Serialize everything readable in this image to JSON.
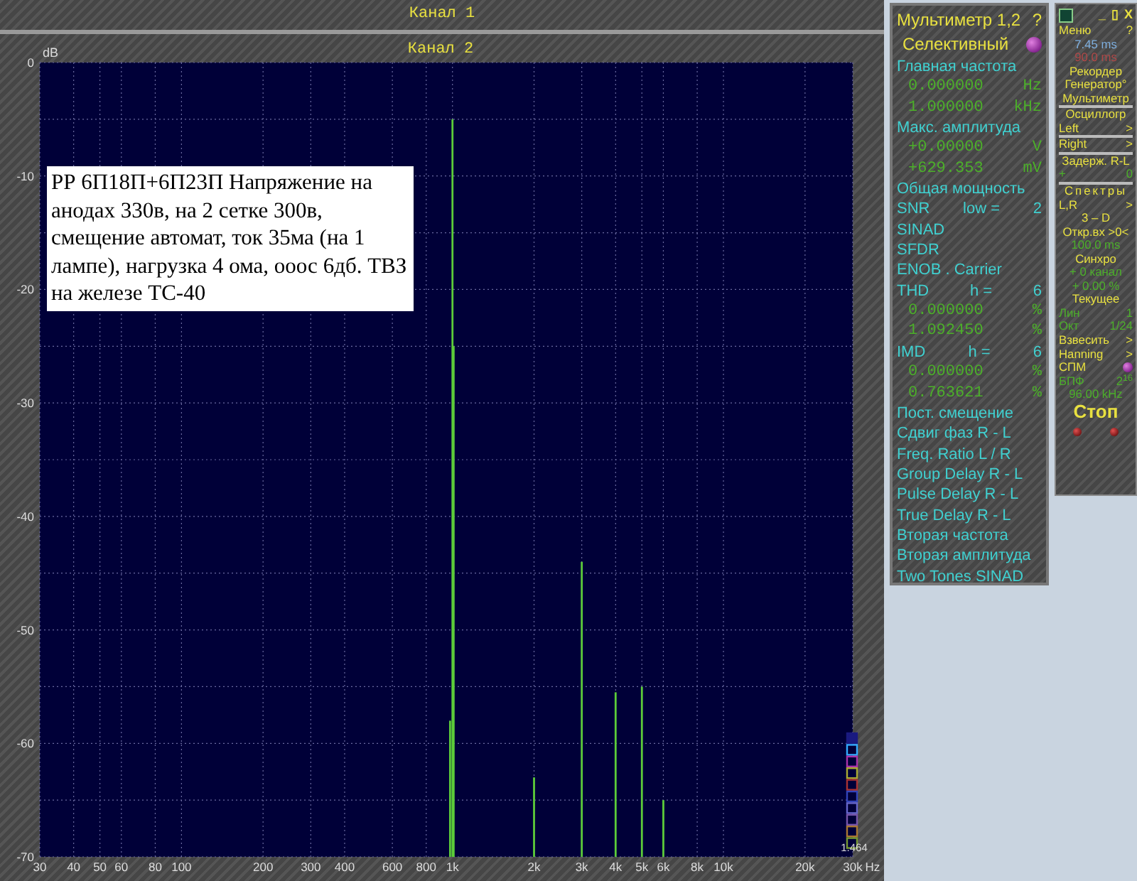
{
  "channel_1": {
    "title": "Канал 1"
  },
  "spectrum": {
    "title": "Канал 2",
    "y_unit": "dB",
    "x_unit": "Hz",
    "y_labels": [
      "0",
      "-10",
      "-20",
      "-30",
      "-40",
      "-50",
      "-60",
      "-70"
    ],
    "x_labels": [
      "30",
      "40",
      "50",
      "60",
      "80",
      "100",
      "200",
      "300",
      "400",
      "600",
      "800",
      "1k",
      "2k",
      "3k",
      "4k",
      "5k",
      "6k",
      "8k",
      "10k",
      "20k",
      "30k"
    ],
    "note": "РР 6П18П+6П23П Напряжение на анодах 330в, на 2 сетке 300в, смещение автомат, ток 35ма (на 1 лампе), нагрузка 4 ома, ооос 6дб. ТВЗ на железе ТС-40",
    "swatches": [
      {
        "color": "#1a1a80"
      },
      {
        "color": "#33aaff"
      },
      {
        "color": "#aa33aa"
      },
      {
        "color": "#aaaa33"
      },
      {
        "color": "#aa3333"
      },
      {
        "color": "#3344bb"
      },
      {
        "color": "#6666cc"
      },
      {
        "color": "#7755aa"
      },
      {
        "color": "#aa7733"
      },
      {
        "color": "#779933"
      }
    ],
    "scale_reading": "1.464"
  },
  "multimeter": {
    "title": "Мультиметр 1,2",
    "help": "?",
    "mode": "Селективный",
    "rows": [
      {
        "kind": "label",
        "cells": [
          "Главная частота"
        ]
      },
      {
        "kind": "value",
        "cells": [
          "0.000000",
          "Hz"
        ]
      },
      {
        "kind": "value",
        "cells": [
          "1.000000",
          "kHz"
        ]
      },
      {
        "kind": "label",
        "cells": [
          "Макс. амплитуда"
        ]
      },
      {
        "kind": "value",
        "cells": [
          "+0.00000",
          "V"
        ]
      },
      {
        "kind": "value",
        "cells": [
          "+629.353",
          "mV"
        ]
      },
      {
        "kind": "label",
        "cells": [
          "Общая мощность"
        ]
      },
      {
        "kind": "label",
        "cells": [
          "SNR",
          "low =",
          "2"
        ]
      },
      {
        "kind": "label",
        "cells": [
          "SINAD"
        ]
      },
      {
        "kind": "label",
        "cells": [
          "SFDR"
        ]
      },
      {
        "kind": "label",
        "cells": [
          "ENOB . Carrier"
        ]
      },
      {
        "kind": "label",
        "cells": [
          "THD",
          "h =",
          "6"
        ]
      },
      {
        "kind": "value",
        "cells": [
          "0.000000",
          "%"
        ]
      },
      {
        "kind": "value",
        "cells": [
          "1.092450",
          "%"
        ]
      },
      {
        "kind": "label",
        "cells": [
          "IMD",
          "h =",
          "6"
        ]
      },
      {
        "kind": "value",
        "cells": [
          "0.000000",
          "%"
        ]
      },
      {
        "kind": "value",
        "cells": [
          "0.763621",
          "%"
        ]
      },
      {
        "kind": "label",
        "cells": [
          "Пост. смещение"
        ]
      },
      {
        "kind": "label",
        "cells": [
          "Сдвиг фаз R - L"
        ]
      },
      {
        "kind": "label",
        "cells": [
          "Freq. Ratio  L / R"
        ]
      },
      {
        "kind": "label",
        "cells": [
          "Group Delay R - L"
        ]
      },
      {
        "kind": "label",
        "cells": [
          "Pulse Delay R - L"
        ]
      },
      {
        "kind": "label",
        "cells": [
          "True Delay R - L"
        ]
      },
      {
        "kind": "label",
        "cells": [
          "Вторая частота"
        ]
      },
      {
        "kind": "label",
        "cells": [
          "Вторая амплитуда"
        ]
      },
      {
        "kind": "label",
        "cells": [
          "Two Tones SINAD"
        ]
      }
    ]
  },
  "control_panel": {
    "rows": [
      {
        "kind": "titlebar",
        "cells": [
          "_",
          "▯",
          "X"
        ]
      },
      {
        "kind": "row",
        "color": "#e8e040",
        "divider_above": false,
        "cells": [
          "Меню",
          "?"
        ]
      },
      {
        "kind": "row",
        "color": "#7fb0e0",
        "divider_above": false,
        "cells": [
          "7.45 ms"
        ]
      },
      {
        "kind": "row",
        "color": "#b04848",
        "divider_above": false,
        "cells": [
          "90.0 ms"
        ]
      },
      {
        "kind": "row",
        "color": "#e8e040",
        "divider_above": false,
        "cells": [
          "Рекордер"
        ]
      },
      {
        "kind": "row",
        "color": "#e8e040",
        "divider_above": false,
        "cells": [
          "Генератор°"
        ]
      },
      {
        "kind": "row",
        "color": "#e8e040",
        "divider_above": false,
        "cells": [
          "Мультиметр"
        ]
      },
      {
        "kind": "row",
        "color": "#e8e040",
        "divider_above": true,
        "cells": [
          "Осциллогр"
        ]
      },
      {
        "kind": "row",
        "color": "#e8e040",
        "divider_above": false,
        "cells": [
          "Left",
          ">"
        ]
      },
      {
        "kind": "row",
        "color": "#e8e040",
        "divider_above": true,
        "cells": [
          "Right",
          ">"
        ]
      },
      {
        "kind": "row",
        "color": "#e8e040",
        "divider_above": true,
        "cells": [
          "Задерж. R-L"
        ]
      },
      {
        "kind": "row",
        "color": "#4caf2a",
        "divider_above": false,
        "cells": [
          "+",
          "0"
        ]
      },
      {
        "kind": "heading",
        "color": "#e8e040",
        "divider_above": true,
        "cells": [
          "Спектры"
        ]
      },
      {
        "kind": "row",
        "color": "#e8e040",
        "divider_above": false,
        "cells": [
          "L,R",
          ">"
        ]
      },
      {
        "kind": "row",
        "color": "#e8e040",
        "divider_above": false,
        "cells": [
          "3 – D"
        ]
      },
      {
        "kind": "row",
        "color": "#e8e040",
        "divider_above": false,
        "cells": [
          "Откр.вх >0<"
        ]
      },
      {
        "kind": "row",
        "color": "#4caf2a",
        "divider_above": false,
        "cells": [
          "100.0 ms"
        ]
      },
      {
        "kind": "row",
        "color": "#e8e040",
        "divider_above": false,
        "cells": [
          "Синхро"
        ]
      },
      {
        "kind": "row",
        "color": "#4caf2a",
        "divider_above": false,
        "cells": [
          "+ 0 канал"
        ]
      },
      {
        "kind": "row",
        "color": "#4caf2a",
        "divider_above": false,
        "cells": [
          "+ 0.00 %"
        ]
      },
      {
        "kind": "row",
        "color": "#e8e040",
        "divider_above": false,
        "cells": [
          "Текущее"
        ]
      },
      {
        "kind": "row",
        "color": "#4caf2a",
        "divider_above": false,
        "cells": [
          "Лин",
          "1"
        ]
      },
      {
        "kind": "row",
        "color": "#4caf2a",
        "divider_above": false,
        "cells": [
          "Окт",
          "1/24"
        ]
      },
      {
        "kind": "row",
        "color": "#e8e040",
        "divider_above": false,
        "cells": [
          "Взвесить",
          ">"
        ]
      },
      {
        "kind": "row",
        "color": "#e8e040",
        "divider_above": false,
        "cells": [
          "Hanning",
          ">"
        ]
      },
      {
        "kind": "indicator",
        "color": "#e8e040",
        "divider_above": false,
        "cells": [
          "СПМ"
        ]
      },
      {
        "kind": "row",
        "color": "#4caf2a",
        "divider_above": false,
        "cells": [
          "БПФ",
          "2$^{16}$"
        ]
      },
      {
        "kind": "row",
        "color": "#4caf2a",
        "divider_above": false,
        "cells": [
          "96.00 kHz"
        ]
      },
      {
        "kind": "stop",
        "color": "#e8e040",
        "divider_above": false,
        "cells": [
          "Стоп"
        ]
      },
      {
        "kind": "leds"
      }
    ]
  }
}
